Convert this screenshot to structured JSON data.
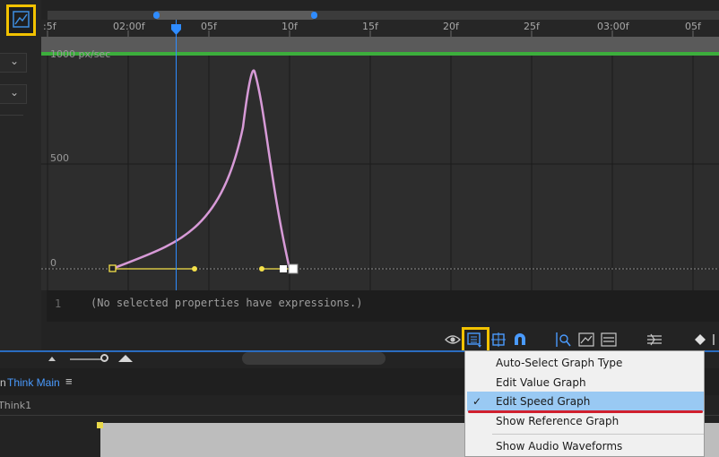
{
  "timeline": {
    "ruler_labels": [
      ":5f",
      "02:00f",
      "05f",
      "10f",
      "15f",
      "20f",
      "25f",
      "03:00f",
      "05f"
    ]
  },
  "graph": {
    "y_label_top": "1000 px/sec",
    "y_label_mid": "500",
    "y_label_zero": "0",
    "curve_color": "#d79ad7",
    "playhead_color": "#2f8cff"
  },
  "expression": {
    "line_number": "1",
    "text": "(No selected properties have expressions.)"
  },
  "toolbar": {
    "icons": [
      "eye-icon",
      "graph-options-icon",
      "snap-icon",
      "magnet-icon",
      "fit-selection-icon",
      "fit-all-icon",
      "zoom-icon",
      "easy-ease-icon",
      "keyframe-icon"
    ]
  },
  "menu": {
    "items": [
      {
        "label": "Auto-Select Graph Type",
        "checked": false
      },
      {
        "label": "Edit Value Graph",
        "checked": false
      },
      {
        "label": "Edit Speed Graph",
        "checked": true
      },
      {
        "label": "Show Reference Graph",
        "checked": false
      },
      {
        "label": "Show Audio Waveforms",
        "checked": false
      }
    ]
  },
  "composition": {
    "prefix": "n",
    "name": "Think Main",
    "layer": "Think1"
  },
  "colors": {
    "highlight": "#f2c200",
    "menu_selected": "#99c9f3",
    "accent_blue": "#2f8cff"
  }
}
